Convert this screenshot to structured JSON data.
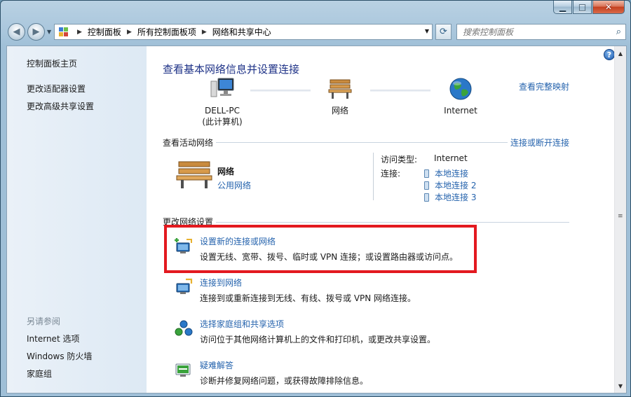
{
  "window": {
    "minimize_glyph": "▁",
    "maximize_glyph": "□",
    "close_glyph": "✕"
  },
  "address": {
    "crumbs": [
      "控制面板",
      "所有控制面板项",
      "网络和共享中心"
    ]
  },
  "search": {
    "placeholder": "搜索控制面板"
  },
  "sidebar": {
    "items": [
      "控制面板主页",
      "更改适配器设置",
      "更改高级共享设置"
    ],
    "see_also_heading": "另请参阅",
    "see_also": [
      "Internet 选项",
      "Windows 防火墙",
      "家庭组"
    ]
  },
  "main": {
    "title": "查看基本网络信息并设置连接",
    "full_map_link": "查看完整映射",
    "map": {
      "computer_name": "DELL-PC",
      "computer_sub": "(此计算机)",
      "network": "网络",
      "internet": "Internet"
    },
    "active": {
      "heading": "查看活动网络",
      "connect_link": "连接或断开连接",
      "network_name": "网络",
      "network_type": "公用网络",
      "access_type_label": "访问类型:",
      "access_type_value": "Internet",
      "connections_label": "连接:",
      "connections": [
        "本地连接",
        "本地连接 2",
        "本地连接 3"
      ]
    },
    "change": {
      "heading": "更改网络设置",
      "tasks": [
        {
          "link": "设置新的连接或网络",
          "desc": "设置无线、宽带、拨号、临时或 VPN 连接；或设置路由器或访问点。"
        },
        {
          "link": "连接到网络",
          "desc": "连接到或重新连接到无线、有线、拨号或 VPN 网络连接。"
        },
        {
          "link": "选择家庭组和共享选项",
          "desc": "访问位于其他网络计算机上的文件和打印机，或更改共享设置。"
        },
        {
          "link": "疑难解答",
          "desc": "诊断并修复网络问题，或获得故障排除信息。"
        }
      ]
    }
  },
  "colors": {
    "link": "#2563ad",
    "title": "#1e3287",
    "highlight": "#e3191f"
  }
}
